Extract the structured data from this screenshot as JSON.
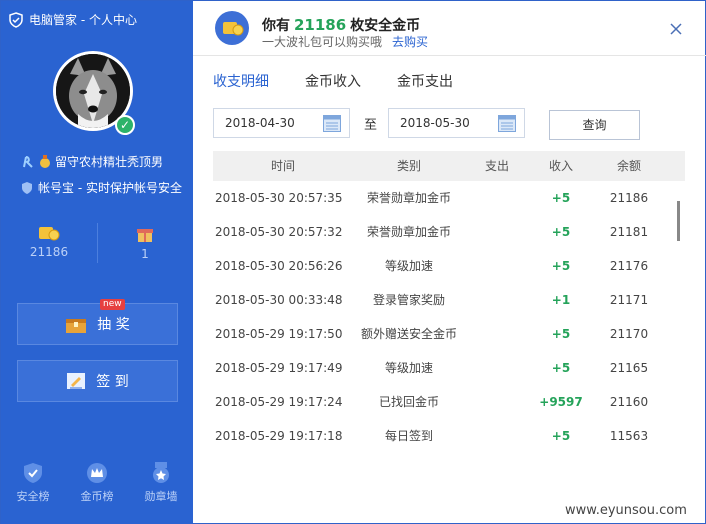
{
  "window": {
    "title": "电脑管家 - 个人中心"
  },
  "profile": {
    "username": "留守农村精壮秃顶男",
    "account_protect": "帐号宝 - 实时保护帐号安全"
  },
  "stats": {
    "coins": "21186",
    "gifts": "1"
  },
  "sidebar_buttons": {
    "lottery": "抽 奖",
    "lottery_badge": "new",
    "sign_in": "签 到"
  },
  "bottom_nav": [
    {
      "label": "安全榜"
    },
    {
      "label": "金币榜"
    },
    {
      "label": "勋章墙"
    }
  ],
  "header": {
    "prefix": "你有",
    "coin_count": "21186",
    "suffix": "枚安全金币",
    "subtitle": "一大波礼包可以购买哦",
    "buy_link": "去购买"
  },
  "tabs": [
    {
      "label": "收支明细",
      "active": true
    },
    {
      "label": "金币收入",
      "active": false
    },
    {
      "label": "金币支出",
      "active": false
    }
  ],
  "filter": {
    "date_from": "2018-04-30",
    "to_label": "至",
    "date_to": "2018-05-30",
    "query_label": "查询"
  },
  "table": {
    "columns": [
      "时间",
      "类别",
      "支出",
      "收入",
      "余额"
    ],
    "rows": [
      {
        "time": "2018-05-30 20:57:35",
        "type": "荣誉勋章加金币",
        "out": "",
        "in": "+5",
        "balance": "21186"
      },
      {
        "time": "2018-05-30 20:57:32",
        "type": "荣誉勋章加金币",
        "out": "",
        "in": "+5",
        "balance": "21181"
      },
      {
        "time": "2018-05-30 20:56:26",
        "type": "等级加速",
        "out": "",
        "in": "+5",
        "balance": "21176"
      },
      {
        "time": "2018-05-30 00:33:48",
        "type": "登录管家奖励",
        "out": "",
        "in": "+1",
        "balance": "21171"
      },
      {
        "time": "2018-05-29 19:17:50",
        "type": "额外赠送安全金币",
        "out": "",
        "in": "+5",
        "balance": "21170"
      },
      {
        "time": "2018-05-29 19:17:49",
        "type": "等级加速",
        "out": "",
        "in": "+5",
        "balance": "21165"
      },
      {
        "time": "2018-05-29 19:17:24",
        "type": "已找回金币",
        "out": "",
        "in": "+9597",
        "balance": "21160"
      },
      {
        "time": "2018-05-29 19:17:18",
        "type": "每日签到",
        "out": "",
        "in": "+5",
        "balance": "11563"
      }
    ]
  },
  "watermark": "www.eyunsou.com",
  "colors": {
    "sidebar": "#2a63d1",
    "accent": "#2a63d1",
    "income": "#25a35a"
  }
}
